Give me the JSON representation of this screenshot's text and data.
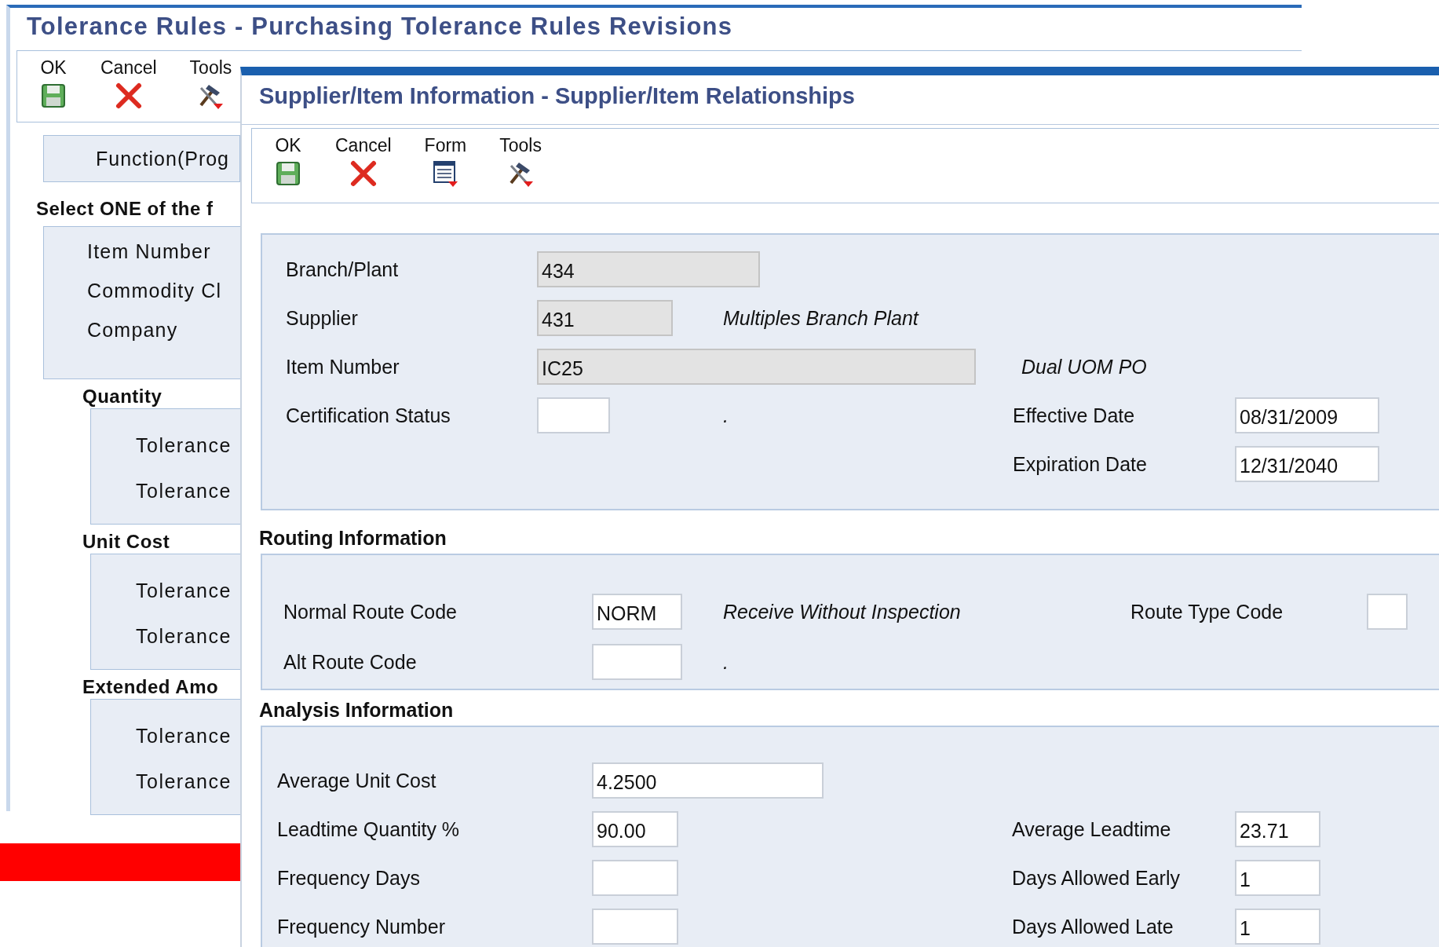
{
  "back_window": {
    "title": "Tolerance Rules - Purchasing Tolerance Rules Revisions",
    "toolbar": [
      {
        "label": "OK"
      },
      {
        "label": "Cancel"
      },
      {
        "label": "Tools"
      }
    ],
    "function_button": "Function(Prog",
    "instruction": "Select ONE of the f",
    "options": [
      "Item Number",
      "Commodity Cl",
      "Company"
    ],
    "groups": [
      {
        "title": "Quantity",
        "items": [
          "Tolerance",
          "Tolerance"
        ]
      },
      {
        "title": "Unit Cost",
        "items": [
          "Tolerance",
          "Tolerance"
        ]
      },
      {
        "title": "Extended Amo",
        "items": [
          "Tolerance",
          "Tolerance"
        ]
      }
    ]
  },
  "front_window": {
    "title": "Supplier/Item Information - Supplier/Item Relationships",
    "toolbar": [
      {
        "label": "OK"
      },
      {
        "label": "Cancel"
      },
      {
        "label": "Form"
      },
      {
        "label": "Tools"
      }
    ],
    "sections": [
      {
        "rows": [
          {
            "label": "Branch/Plant",
            "field": {
              "value": "434",
              "disabled": true
            }
          },
          {
            "label": "Supplier",
            "field": {
              "value": "431",
              "disabled": true
            },
            "note": "Multiples Branch Plant"
          },
          {
            "label": "Item Number",
            "field": {
              "value": "IC25",
              "disabled": true
            },
            "note": "Dual UOM PO"
          },
          {
            "label": "Certification Status",
            "field": {
              "disabled": false
            },
            "note": ".",
            "right": {
              "label": "Effective Date",
              "field": {
                "value": "08/31/2009",
                "disabled": false
              }
            }
          },
          {
            "right": {
              "label": "Expiration Date",
              "field": {
                "value": "12/31/2040",
                "disabled": false
              }
            }
          }
        ]
      },
      {
        "heading": "Routing Information",
        "rows": [
          {
            "label": "Normal Route Code",
            "field": {
              "value": "NORM",
              "disabled": false
            },
            "note": "Receive Without Inspection",
            "right": {
              "label": "Route Type Code",
              "field": {
                "disabled": false
              }
            }
          },
          {
            "label": "Alt Route Code",
            "field": {
              "disabled": false
            },
            "note": "."
          }
        ]
      },
      {
        "heading": "Analysis Information",
        "rows": [
          {
            "label": "Average Unit Cost",
            "field": {
              "value": "4.2500",
              "disabled": false
            }
          },
          {
            "label": "Leadtime Quantity %",
            "field": {
              "value": "90.00",
              "disabled": false
            },
            "right": {
              "label": "Average Leadtime",
              "field": {
                "value": "23.71",
                "disabled": false
              }
            }
          },
          {
            "label": "Frequency Days",
            "field": {
              "disabled": false
            },
            "right": {
              "label": "Days Allowed Early",
              "field": {
                "value": "1",
                "disabled": false
              }
            }
          },
          {
            "label": "Frequency Number",
            "field": {
              "disabled": false
            },
            "right": {
              "label": "Days Allowed Late",
              "field": {
                "value": "1",
                "disabled": false
              }
            }
          }
        ]
      }
    ]
  }
}
